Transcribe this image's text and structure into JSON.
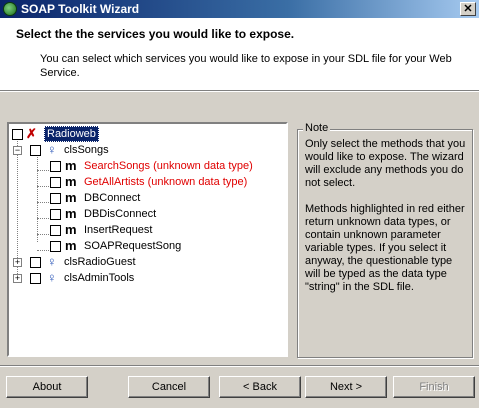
{
  "window": {
    "title": "SOAP Toolkit Wizard",
    "close_glyph": "✕"
  },
  "header": {
    "title": "Select the the services you would like to expose.",
    "description": "You can select which services you would like to expose in your SDL file for your Web Service."
  },
  "tree": {
    "root": {
      "label": "Radioweb",
      "icon": "root-service-icon"
    },
    "classes": [
      {
        "label": "clsSongs",
        "expanded": true,
        "glyph": "−"
      },
      {
        "label": "clsRadioGuest",
        "expanded": false,
        "glyph": "+"
      },
      {
        "label": "clsAdminTools",
        "expanded": false,
        "glyph": "+"
      }
    ],
    "methods": [
      {
        "label": "SearchSongs (unknown data type)",
        "unknown": true
      },
      {
        "label": "GetAllArtists (unknown data type)",
        "unknown": true
      },
      {
        "label": "DBConnect",
        "unknown": false
      },
      {
        "label": "DBDisConnect",
        "unknown": false
      },
      {
        "label": "InsertRequest",
        "unknown": false
      },
      {
        "label": "SOAPRequestSong",
        "unknown": false
      }
    ],
    "method_glyph": "m",
    "class_glyph": "♀",
    "root_glyph": "✗"
  },
  "note": {
    "legend": "Note",
    "paragraph1": "Only select the methods that you would like to expose.  The wizard will exclude any methods you do not select.",
    "paragraph2": "Methods highlighted in red either return unknown data types, or contain unknown parameter variable types.  If you select it anyway, the questionable type will be typed as the data type \"string\" in the SDL file."
  },
  "buttons": {
    "about": "About",
    "cancel": "Cancel",
    "back": "< Back",
    "next": "Next >",
    "finish": "Finish"
  },
  "colors": {
    "unknown_method": "#e00000",
    "title_bar": "#0a246a",
    "class_icon": "#2b56b8"
  }
}
